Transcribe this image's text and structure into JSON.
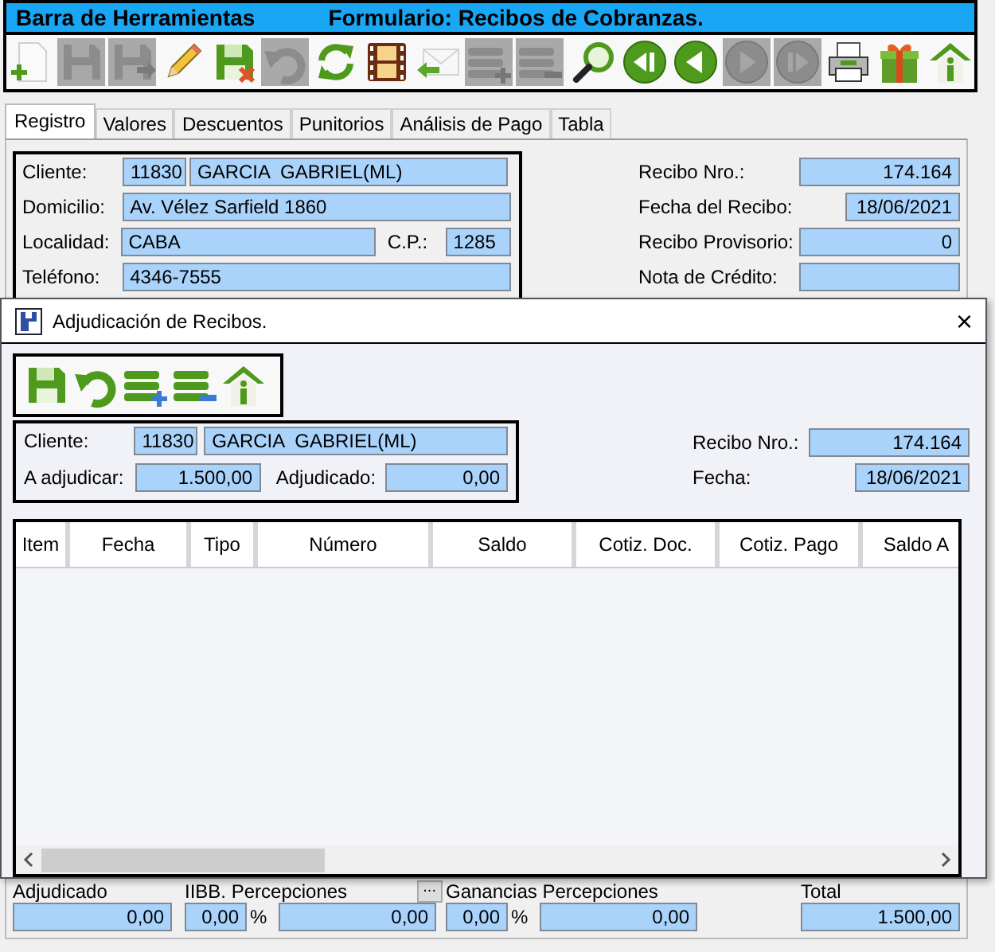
{
  "main_window": {
    "title_left": "Barra de Herramientas",
    "title_right": "Formulario: Recibos de Cobranzas.",
    "toolbar": [
      {
        "disabled": false
      },
      {
        "disabled": true
      },
      {
        "disabled": true
      },
      {
        "disabled": false
      },
      {
        "disabled": false
      },
      {
        "disabled": true
      },
      {
        "disabled": false
      },
      {
        "disabled": false
      },
      {
        "disabled": false
      },
      {
        "disabled": true
      },
      {
        "disabled": true
      },
      {
        "disabled": false
      },
      {
        "disabled": false
      },
      {
        "disabled": false
      },
      {
        "disabled": true
      },
      {
        "disabled": true
      },
      {
        "disabled": false
      },
      {
        "disabled": false
      },
      {
        "disabled": false
      }
    ],
    "tabs": [
      {
        "label": "Registro",
        "selected": true
      },
      {
        "label": "Valores",
        "selected": false
      },
      {
        "label": "Descuentos",
        "selected": false
      },
      {
        "label": "Punitorios",
        "selected": false
      },
      {
        "label": "Análisis de Pago",
        "selected": false
      },
      {
        "label": "Tabla",
        "selected": false
      }
    ],
    "client": {
      "client_label": "Cliente:",
      "client_code": "11830",
      "client_name": "GARCIA  GABRIEL(ML)",
      "address_label": "Domicilio:",
      "address": "Av. Vélez Sarfield 1860",
      "city_label": "Localidad:",
      "city": "CABA",
      "zip_label": "C.P.:",
      "zip": "1285",
      "phone_label": "Teléfono:",
      "phone": "4346-7555"
    },
    "receipt": [
      {
        "label": "Recibo Nro.:",
        "value": "174.164"
      },
      {
        "label": "Fecha del Recibo:",
        "value": "18/06/2021",
        "kind": "date"
      },
      {
        "label": "Recibo Provisorio:",
        "value": "0"
      },
      {
        "label": "Nota de Crédito:"
      }
    ],
    "totals": {
      "adjudicado_label": "Adjudicado",
      "adjudicado": "0,00",
      "iibb_label": "IIBB. Percepciones",
      "iibb_button": "...",
      "iibb_percent": "0,00",
      "iibb_percent_sign": "%",
      "iibb": "0,00",
      "ganancias_label": "Ganancias Percepciones",
      "ganancias_percent": "0,00",
      "ganancias_percent_sign": "%",
      "ganancias": "0,00",
      "total_label": "Total",
      "total": "1.500,00"
    }
  },
  "dialog": {
    "title": "Adjudicación de Recibos.",
    "close": "×",
    "client_label": "Cliente:",
    "client_code": "11830",
    "client_name": "GARCIA  GABRIEL(ML)",
    "to_assign_label": "A adjudicar:",
    "to_assign": "1.500,00",
    "assigned_label": "Adjudicado:",
    "assigned": "0,00",
    "receipt": [
      {
        "label": "Recibo Nro.:",
        "value": "174.164"
      },
      {
        "label": "Fecha:",
        "value": "18/06/2021",
        "kind": "date"
      }
    ],
    "table": {
      "columns": [
        "Item",
        "Fecha",
        "Tipo",
        "Número",
        "Saldo",
        "Cotiz. Doc.",
        "Cotiz. Pago",
        "Saldo A"
      ]
    }
  }
}
